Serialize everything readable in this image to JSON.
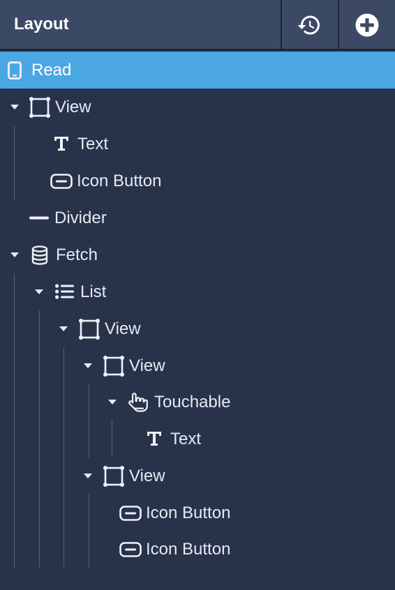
{
  "header": {
    "title": "Layout",
    "history_icon": "history-icon",
    "add_icon": "add-circle-icon"
  },
  "colors": {
    "background": "#28334a",
    "header": "#3c4965",
    "selected": "#4aa7e2",
    "text": "#e6eaf1"
  },
  "tree": {
    "items": [
      {
        "label": "Read",
        "icon": "phone-icon",
        "selected": true
      },
      {
        "label": "View",
        "icon": "view-frame-icon",
        "expanded": true
      },
      {
        "label": "Text",
        "icon": "text-icon"
      },
      {
        "label": "Icon Button",
        "icon": "icon-button-icon"
      },
      {
        "label": "Divider",
        "icon": "divider-icon"
      },
      {
        "label": "Fetch",
        "icon": "database-icon",
        "expanded": true
      },
      {
        "label": "List",
        "icon": "list-icon",
        "expanded": true
      },
      {
        "label": "View",
        "icon": "view-frame-icon",
        "expanded": true
      },
      {
        "label": "View",
        "icon": "view-frame-icon",
        "expanded": true
      },
      {
        "label": "Touchable",
        "icon": "touch-hand-icon",
        "expanded": true
      },
      {
        "label": "Text",
        "icon": "text-icon"
      },
      {
        "label": "View",
        "icon": "view-frame-icon",
        "expanded": true
      },
      {
        "label": "Icon Button",
        "icon": "icon-button-icon"
      },
      {
        "label": "Icon Button",
        "icon": "icon-button-icon"
      }
    ]
  }
}
